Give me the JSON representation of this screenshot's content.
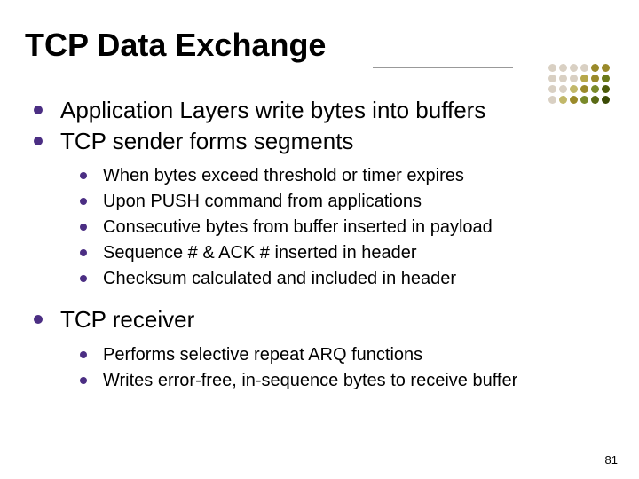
{
  "title": "TCP Data Exchange",
  "bullets": {
    "b1": "Application Layers write bytes into buffers",
    "b2": "TCP sender forms segments",
    "b2_sub": {
      "s1": "When bytes exceed threshold or timer expires",
      "s2": "Upon PUSH command from applications",
      "s3": "Consecutive bytes from buffer inserted in payload",
      "s4": "Sequence # & ACK # inserted in header",
      "s5": "Checksum calculated and included in header"
    },
    "b3": "TCP receiver",
    "b3_sub": {
      "s1": "Performs selective repeat ARQ functions",
      "s2": "Writes error-free, in-sequence bytes to receive buffer"
    }
  },
  "page_number": "81",
  "decor": {
    "dot_colors": [
      "#d9d0c3",
      "#d9d0c3",
      "#d9d0c3",
      "#d9d0c3",
      "#9a8a2a",
      "#9a8a2a",
      "#d9d0c3",
      "#d9d0c3",
      "#d9d0c3",
      "#b7a84a",
      "#9a8a2a",
      "#6b7a1a",
      "#d9d0c3",
      "#d9d0c3",
      "#c2b86a",
      "#9a8a2a",
      "#7a8a2a",
      "#4b5a0a",
      "#d9d0c3",
      "#c2b86a",
      "#9a8a2a",
      "#7a8a2a",
      "#5a6a15",
      "#3a4a05"
    ]
  }
}
